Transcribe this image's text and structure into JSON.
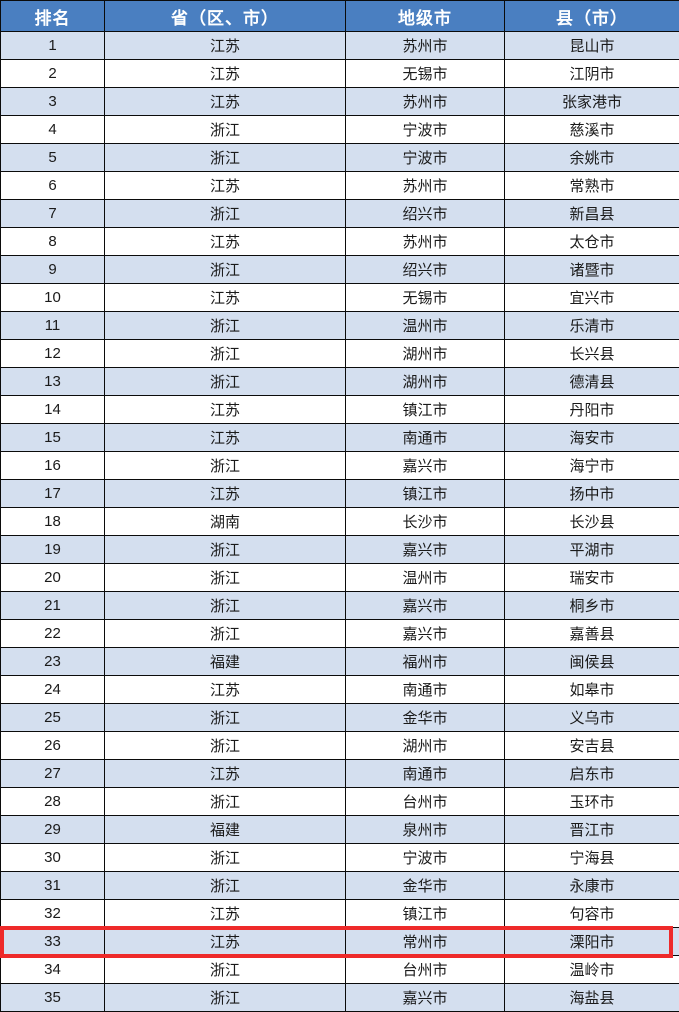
{
  "table": {
    "columns": [
      {
        "key": "rank",
        "label": "排名"
      },
      {
        "key": "province",
        "label": "省（区、市）"
      },
      {
        "key": "city",
        "label": "地级市"
      },
      {
        "key": "county",
        "label": "县（市）"
      }
    ],
    "header_bg": "#4a7fc1",
    "header_color": "#ffffff",
    "shade_bg": "#d4dfef",
    "plain_bg": "#ffffff",
    "highlight_color": "#ee2a2a",
    "highlighted_rank": "33",
    "rows": [
      {
        "rank": "1",
        "province": "江苏",
        "city": "苏州市",
        "county": "昆山市"
      },
      {
        "rank": "2",
        "province": "江苏",
        "city": "无锡市",
        "county": "江阴市"
      },
      {
        "rank": "3",
        "province": "江苏",
        "city": "苏州市",
        "county": "张家港市"
      },
      {
        "rank": "4",
        "province": "浙江",
        "city": "宁波市",
        "county": "慈溪市"
      },
      {
        "rank": "5",
        "province": "浙江",
        "city": "宁波市",
        "county": "余姚市"
      },
      {
        "rank": "6",
        "province": "江苏",
        "city": "苏州市",
        "county": "常熟市"
      },
      {
        "rank": "7",
        "province": "浙江",
        "city": "绍兴市",
        "county": "新昌县"
      },
      {
        "rank": "8",
        "province": "江苏",
        "city": "苏州市",
        "county": "太仓市"
      },
      {
        "rank": "9",
        "province": "浙江",
        "city": "绍兴市",
        "county": "诸暨市"
      },
      {
        "rank": "10",
        "province": "江苏",
        "city": "无锡市",
        "county": "宜兴市"
      },
      {
        "rank": "11",
        "province": "浙江",
        "city": "温州市",
        "county": "乐清市"
      },
      {
        "rank": "12",
        "province": "浙江",
        "city": "湖州市",
        "county": "长兴县"
      },
      {
        "rank": "13",
        "province": "浙江",
        "city": "湖州市",
        "county": "德清县"
      },
      {
        "rank": "14",
        "province": "江苏",
        "city": "镇江市",
        "county": "丹阳市"
      },
      {
        "rank": "15",
        "province": "江苏",
        "city": "南通市",
        "county": "海安市"
      },
      {
        "rank": "16",
        "province": "浙江",
        "city": "嘉兴市",
        "county": "海宁市"
      },
      {
        "rank": "17",
        "province": "江苏",
        "city": "镇江市",
        "county": "扬中市"
      },
      {
        "rank": "18",
        "province": "湖南",
        "city": "长沙市",
        "county": "长沙县"
      },
      {
        "rank": "19",
        "province": "浙江",
        "city": "嘉兴市",
        "county": "平湖市"
      },
      {
        "rank": "20",
        "province": "浙江",
        "city": "温州市",
        "county": "瑞安市"
      },
      {
        "rank": "21",
        "province": "浙江",
        "city": "嘉兴市",
        "county": "桐乡市"
      },
      {
        "rank": "22",
        "province": "浙江",
        "city": "嘉兴市",
        "county": "嘉善县"
      },
      {
        "rank": "23",
        "province": "福建",
        "city": "福州市",
        "county": "闽侯县"
      },
      {
        "rank": "24",
        "province": "江苏",
        "city": "南通市",
        "county": "如皋市"
      },
      {
        "rank": "25",
        "province": "浙江",
        "city": "金华市",
        "county": "义乌市"
      },
      {
        "rank": "26",
        "province": "浙江",
        "city": "湖州市",
        "county": "安吉县"
      },
      {
        "rank": "27",
        "province": "江苏",
        "city": "南通市",
        "county": "启东市"
      },
      {
        "rank": "28",
        "province": "浙江",
        "city": "台州市",
        "county": "玉环市"
      },
      {
        "rank": "29",
        "province": "福建",
        "city": "泉州市",
        "county": "晋江市"
      },
      {
        "rank": "30",
        "province": "浙江",
        "city": "宁波市",
        "county": "宁海县"
      },
      {
        "rank": "31",
        "province": "浙江",
        "city": "金华市",
        "county": "永康市"
      },
      {
        "rank": "32",
        "province": "江苏",
        "city": "镇江市",
        "county": "句容市"
      },
      {
        "rank": "33",
        "province": "江苏",
        "city": "常州市",
        "county": "溧阳市"
      },
      {
        "rank": "34",
        "province": "浙江",
        "city": "台州市",
        "county": "温岭市"
      },
      {
        "rank": "35",
        "province": "浙江",
        "city": "嘉兴市",
        "county": "海盐县"
      }
    ]
  }
}
